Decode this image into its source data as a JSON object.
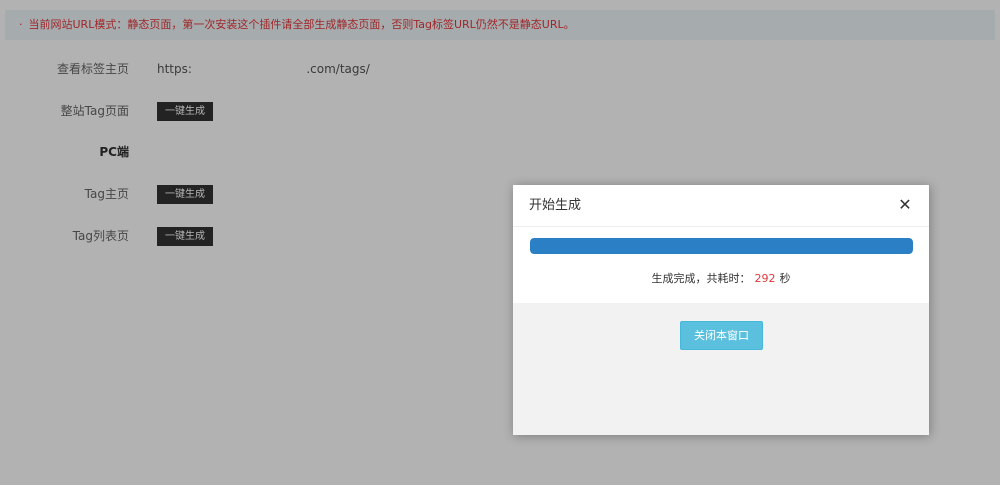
{
  "notice": {
    "bullet": "·",
    "text": "当前网站URL模式：静态页面，第一次安装这个插件请全部生成静态页面，否则Tag标签URL仍然不是静态URL。"
  },
  "settings": {
    "rows": [
      {
        "label": "查看标签主页",
        "value": "https:                              .com/tags/"
      },
      {
        "label": "整站Tag页面",
        "button": "一键生成"
      },
      {
        "label": "PC端"
      },
      {
        "label": "Tag主页",
        "button": "一键生成"
      },
      {
        "label": "Tag列表页",
        "button": "一键生成"
      }
    ]
  },
  "dialog": {
    "title": "开始生成",
    "close_icon": "close-icon",
    "progress_percent": 100,
    "status_prefix": "生成完成，共耗时：",
    "elapsed": "292",
    "status_suffix": "秒",
    "close_button": "关闭本窗口"
  },
  "colors": {
    "notice_text": "#e4393c",
    "progress": "#2b7fc4",
    "close_button": "#5bc0de",
    "action_button": "#333333"
  }
}
